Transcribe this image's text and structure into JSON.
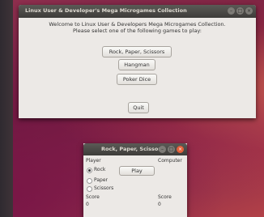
{
  "main_window": {
    "title": "Linux User & Developer's Mega Microgames Collection",
    "welcome_line1": "Welcome to Linux User & Developers Mega Microgames Collection.",
    "welcome_line2": "Please select one of the following games to play:",
    "buttons": {
      "rps": "Rock, Paper, Scissors",
      "hangman": "Hangman",
      "poker": "Poker Dice",
      "quit": "Quit"
    }
  },
  "rps_window": {
    "title": "Rock, Paper, Scissors",
    "player_label": "Player",
    "computer_label": "Computer",
    "options": [
      "Rock",
      "Paper",
      "Scissors"
    ],
    "selected": "Rock",
    "play_label": "Play",
    "score_label_player": "Score",
    "score_label_computer": "Score",
    "score_player": "0",
    "score_computer": "0"
  },
  "colors": {
    "desktop_accent": "#8f2f4e",
    "window_bg": "#ece9e6",
    "titlebar": "#3d3c39",
    "close_button": "#e2603a"
  }
}
